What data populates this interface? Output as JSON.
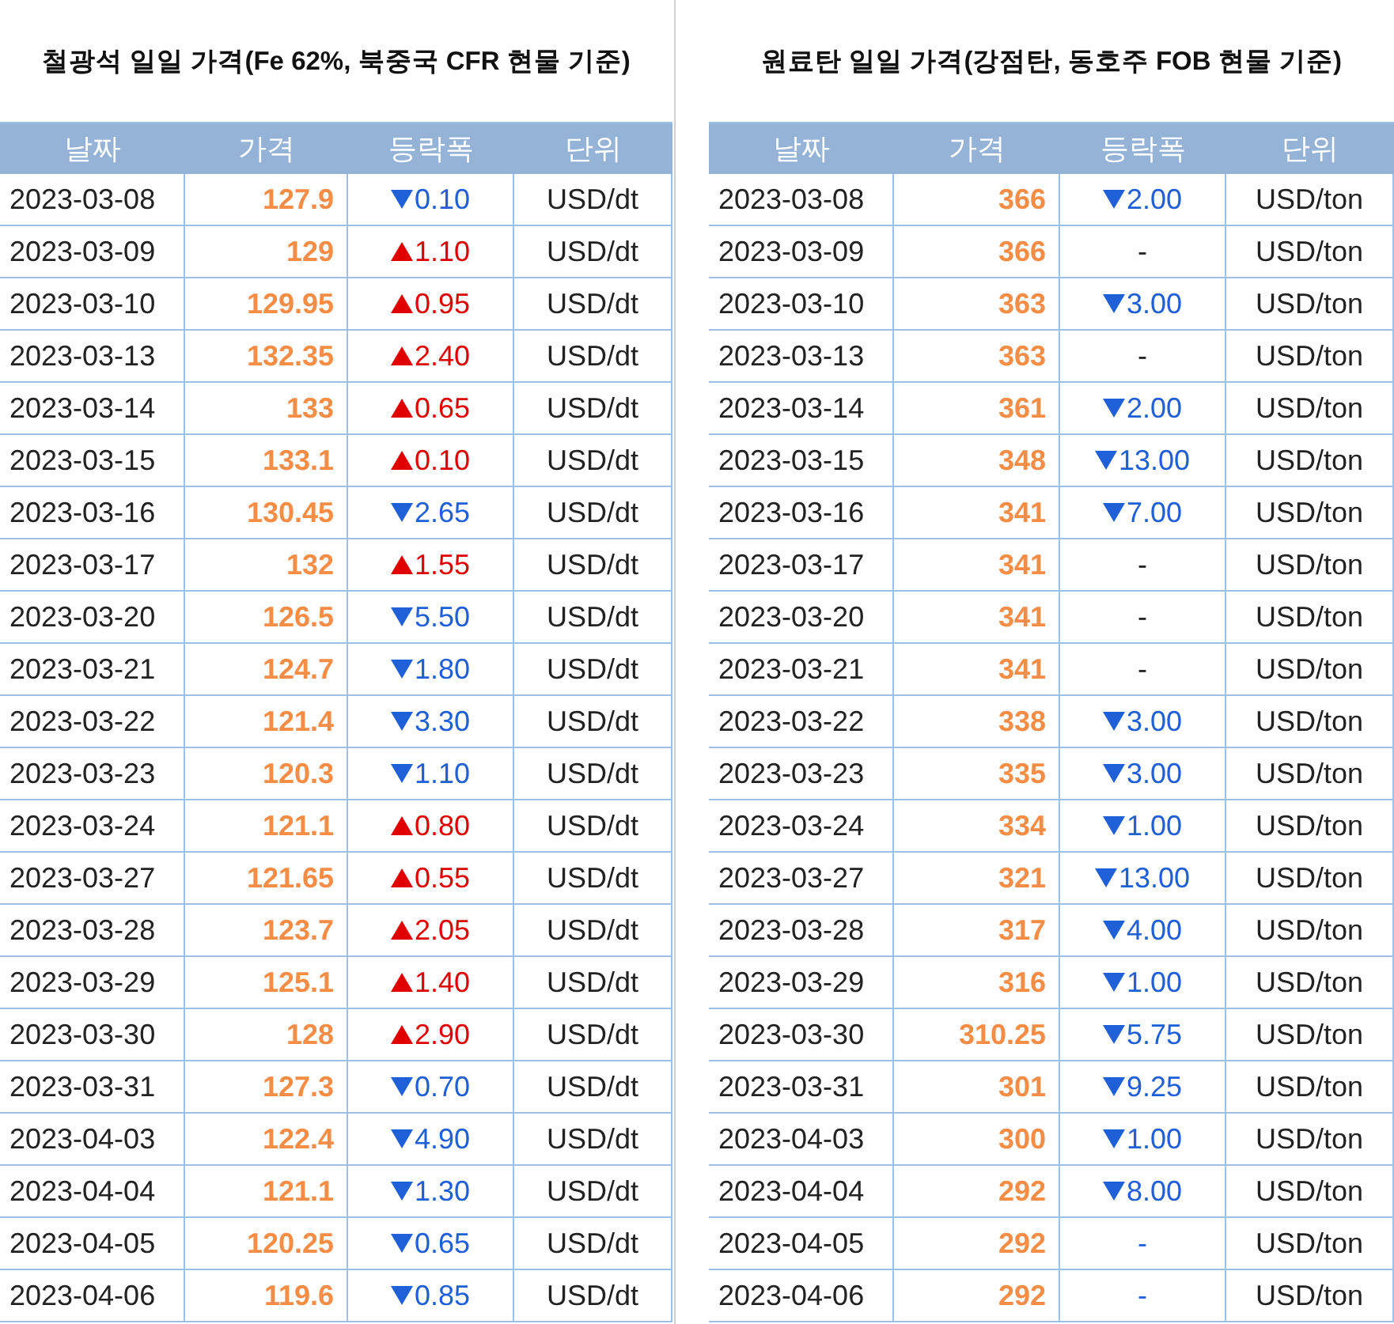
{
  "tables": [
    {
      "title": "철광석 일일 가격(Fe 62%, 북중국 CFR 현물 기준)",
      "columns": [
        "날짜",
        "가격",
        "등락폭",
        "단위"
      ],
      "rows": [
        {
          "date": "2023-03-08",
          "price": "127.9",
          "kind": "down",
          "color": "#1f5fd8",
          "change": "0.10",
          "unit": "USD/dt"
        },
        {
          "date": "2023-03-09",
          "price": "129",
          "kind": "up",
          "color": "#e00000",
          "change": "1.10",
          "unit": "USD/dt"
        },
        {
          "date": "2023-03-10",
          "price": "129.95",
          "kind": "up",
          "color": "#e00000",
          "change": "0.95",
          "unit": "USD/dt"
        },
        {
          "date": "2023-03-13",
          "price": "132.35",
          "kind": "up",
          "color": "#e00000",
          "change": "2.40",
          "unit": "USD/dt"
        },
        {
          "date": "2023-03-14",
          "price": "133",
          "kind": "up",
          "color": "#e00000",
          "change": "0.65",
          "unit": "USD/dt"
        },
        {
          "date": "2023-03-15",
          "price": "133.1",
          "kind": "up",
          "color": "#e00000",
          "change": "0.10",
          "unit": "USD/dt"
        },
        {
          "date": "2023-03-16",
          "price": "130.45",
          "kind": "down",
          "color": "#1f5fd8",
          "change": "2.65",
          "unit": "USD/dt"
        },
        {
          "date": "2023-03-17",
          "price": "132",
          "kind": "up",
          "color": "#e00000",
          "change": "1.55",
          "unit": "USD/dt"
        },
        {
          "date": "2023-03-20",
          "price": "126.5",
          "kind": "down",
          "color": "#1f5fd8",
          "change": "5.50",
          "unit": "USD/dt"
        },
        {
          "date": "2023-03-21",
          "price": "124.7",
          "kind": "down",
          "color": "#1f5fd8",
          "change": "1.80",
          "unit": "USD/dt"
        },
        {
          "date": "2023-03-22",
          "price": "121.4",
          "kind": "down",
          "color": "#1f5fd8",
          "change": "3.30",
          "unit": "USD/dt"
        },
        {
          "date": "2023-03-23",
          "price": "120.3",
          "kind": "down",
          "color": "#1f5fd8",
          "change": "1.10",
          "unit": "USD/dt"
        },
        {
          "date": "2023-03-24",
          "price": "121.1",
          "kind": "up",
          "color": "#e00000",
          "change": "0.80",
          "unit": "USD/dt"
        },
        {
          "date": "2023-03-27",
          "price": "121.65",
          "kind": "up",
          "color": "#e00000",
          "change": "0.55",
          "unit": "USD/dt"
        },
        {
          "date": "2023-03-28",
          "price": "123.7",
          "kind": "up",
          "color": "#e00000",
          "change": "2.05",
          "unit": "USD/dt"
        },
        {
          "date": "2023-03-29",
          "price": "125.1",
          "kind": "up",
          "color": "#e00000",
          "change": "1.40",
          "unit": "USD/dt"
        },
        {
          "date": "2023-03-30",
          "price": "128",
          "kind": "up",
          "color": "#e00000",
          "change": "2.90",
          "unit": "USD/dt"
        },
        {
          "date": "2023-03-31",
          "price": "127.3",
          "kind": "down",
          "color": "#1f5fd8",
          "change": "0.70",
          "unit": "USD/dt"
        },
        {
          "date": "2023-04-03",
          "price": "122.4",
          "kind": "down",
          "color": "#1f5fd8",
          "change": "4.90",
          "unit": "USD/dt"
        },
        {
          "date": "2023-04-04",
          "price": "121.1",
          "kind": "down",
          "color": "#1f5fd8",
          "change": "1.30",
          "unit": "USD/dt"
        },
        {
          "date": "2023-04-05",
          "price": "120.25",
          "kind": "down",
          "color": "#1f5fd8",
          "change": "0.65",
          "unit": "USD/dt"
        },
        {
          "date": "2023-04-06",
          "price": "119.6",
          "kind": "down",
          "color": "#1f5fd8",
          "change": "0.85",
          "unit": "USD/dt"
        }
      ]
    },
    {
      "title": "원료탄 일일 가격(강점탄, 동호주 FOB 현물 기준)",
      "columns": [
        "날짜",
        "가격",
        "등락폭",
        "단위"
      ],
      "rows": [
        {
          "date": "2023-03-08",
          "price": "366",
          "kind": "down",
          "color": "#1f5fd8",
          "change": "2.00",
          "unit": "USD/ton"
        },
        {
          "date": "2023-03-09",
          "price": "366",
          "kind": "flat",
          "color": "#222222",
          "change": "-",
          "unit": "USD/ton"
        },
        {
          "date": "2023-03-10",
          "price": "363",
          "kind": "down",
          "color": "#1f5fd8",
          "change": "3.00",
          "unit": "USD/ton"
        },
        {
          "date": "2023-03-13",
          "price": "363",
          "kind": "flat",
          "color": "#222222",
          "change": "-",
          "unit": "USD/ton"
        },
        {
          "date": "2023-03-14",
          "price": "361",
          "kind": "down",
          "color": "#1f5fd8",
          "change": "2.00",
          "unit": "USD/ton"
        },
        {
          "date": "2023-03-15",
          "price": "348",
          "kind": "down",
          "color": "#1f5fd8",
          "change": "13.00",
          "unit": "USD/ton"
        },
        {
          "date": "2023-03-16",
          "price": "341",
          "kind": "down",
          "color": "#1f5fd8",
          "change": "7.00",
          "unit": "USD/ton"
        },
        {
          "date": "2023-03-17",
          "price": "341",
          "kind": "flat",
          "color": "#222222",
          "change": "-",
          "unit": "USD/ton"
        },
        {
          "date": "2023-03-20",
          "price": "341",
          "kind": "flat",
          "color": "#222222",
          "change": "-",
          "unit": "USD/ton"
        },
        {
          "date": "2023-03-21",
          "price": "341",
          "kind": "flat",
          "color": "#222222",
          "change": "-",
          "unit": "USD/ton"
        },
        {
          "date": "2023-03-22",
          "price": "338",
          "kind": "down",
          "color": "#1f5fd8",
          "change": "3.00",
          "unit": "USD/ton"
        },
        {
          "date": "2023-03-23",
          "price": "335",
          "kind": "down",
          "color": "#1f5fd8",
          "change": "3.00",
          "unit": "USD/ton"
        },
        {
          "date": "2023-03-24",
          "price": "334",
          "kind": "down",
          "color": "#1f5fd8",
          "change": "1.00",
          "unit": "USD/ton"
        },
        {
          "date": "2023-03-27",
          "price": "321",
          "kind": "down",
          "color": "#1f5fd8",
          "change": "13.00",
          "unit": "USD/ton"
        },
        {
          "date": "2023-03-28",
          "price": "317",
          "kind": "down",
          "color": "#1f5fd8",
          "change": "4.00",
          "unit": "USD/ton"
        },
        {
          "date": "2023-03-29",
          "price": "316",
          "kind": "down",
          "color": "#1f5fd8",
          "change": "1.00",
          "unit": "USD/ton"
        },
        {
          "date": "2023-03-30",
          "price": "310.25",
          "kind": "down",
          "color": "#1f5fd8",
          "change": "5.75",
          "unit": "USD/ton"
        },
        {
          "date": "2023-03-31",
          "price": "301",
          "kind": "down",
          "color": "#1f5fd8",
          "change": "9.25",
          "unit": "USD/ton"
        },
        {
          "date": "2023-04-03",
          "price": "300",
          "kind": "down",
          "color": "#1f5fd8",
          "change": "1.00",
          "unit": "USD/ton"
        },
        {
          "date": "2023-04-04",
          "price": "292",
          "kind": "down",
          "color": "#1f5fd8",
          "change": "8.00",
          "unit": "USD/ton"
        },
        {
          "date": "2023-04-05",
          "price": "292",
          "kind": "flat",
          "color": "#1f5fd8",
          "change": "-",
          "unit": "USD/ton"
        },
        {
          "date": "2023-04-06",
          "price": "292",
          "kind": "flat",
          "color": "#1f5fd8",
          "change": "-",
          "unit": "USD/ton"
        }
      ]
    }
  ]
}
